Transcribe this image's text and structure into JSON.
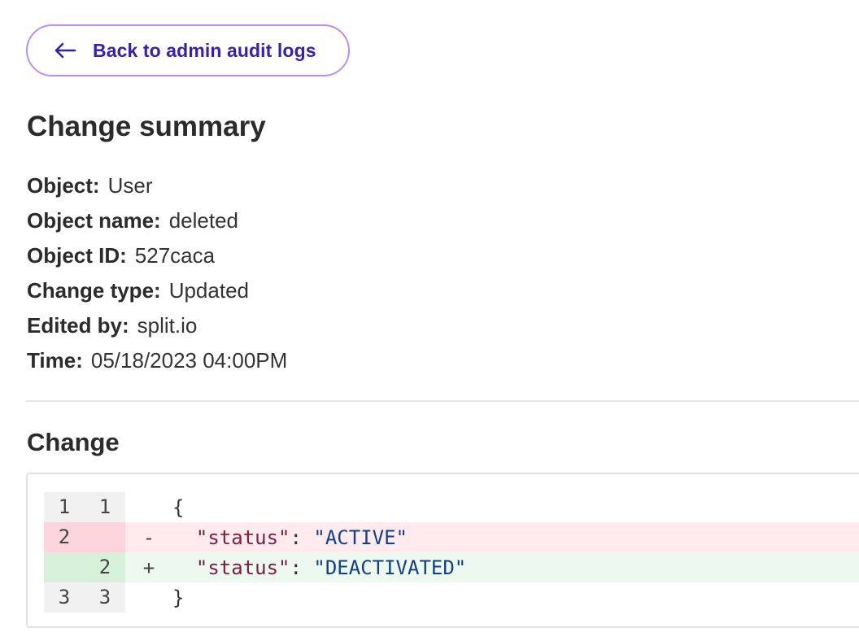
{
  "back_button": {
    "label": "Back to admin audit logs",
    "icon": "arrow-left-icon",
    "color": "#3a1fa8",
    "border_color": "#b98ef0"
  },
  "change_summary": {
    "title": "Change summary",
    "fields": [
      {
        "key": "Object:",
        "value": "User"
      },
      {
        "key": "Object name:",
        "value": "deleted"
      },
      {
        "key": "Object ID:",
        "value": "527caca"
      },
      {
        "key": "Change type:",
        "value": "Updated"
      },
      {
        "key": "Edited by:",
        "value": "split.io"
      },
      {
        "key": "Time:",
        "value": "05/18/2023 04:00PM"
      }
    ]
  },
  "change": {
    "title": "Change",
    "lines": [
      {
        "type": "context",
        "old": "1",
        "new": "1",
        "sign": "",
        "open": "{"
      },
      {
        "type": "removed",
        "old": "2",
        "new": "",
        "sign": "-",
        "key": "\"status\"",
        "colon": ":",
        "value": "\"ACTIVE\""
      },
      {
        "type": "added",
        "old": "",
        "new": "2",
        "sign": "+",
        "key": "\"status\"",
        "colon": ":",
        "value": "\"DEACTIVATED\""
      },
      {
        "type": "context",
        "old": "3",
        "new": "3",
        "sign": "",
        "open": "}"
      }
    ],
    "colors": {
      "removed_bg": "#ffebee",
      "added_bg": "#edf8ee",
      "key": "#7a1e45",
      "string": "#123e8a"
    }
  }
}
